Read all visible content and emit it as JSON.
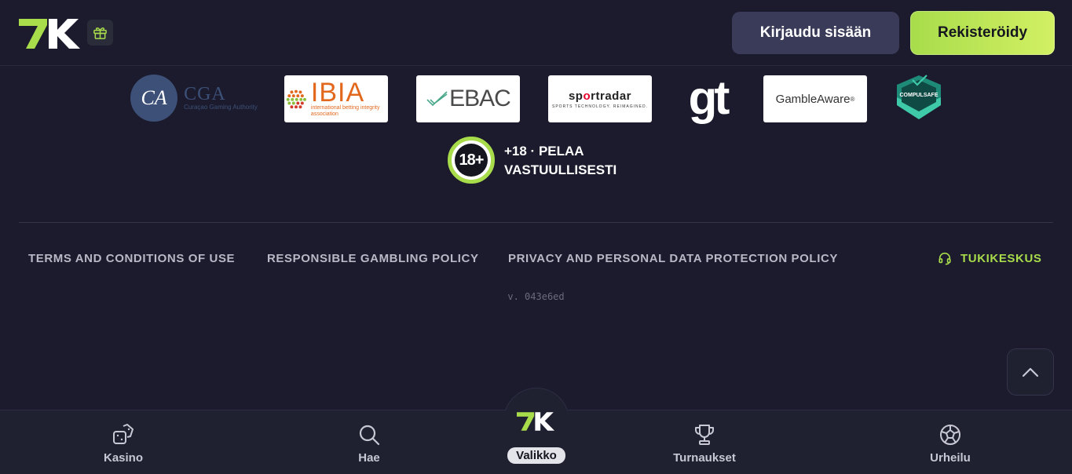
{
  "header": {
    "logo_text": "7K",
    "login_label": "Kirjaudu sisään",
    "register_label": "Rekisteröidy"
  },
  "partners": {
    "cga": {
      "monogram": "CA",
      "title": "CGA",
      "subtitle": "Curaçao Gaming Authority"
    },
    "ibia": {
      "title": "IBIA",
      "subtitle": "international betting integrity association"
    },
    "ebac": {
      "title": "EBAC"
    },
    "sportradar": {
      "title_a": "sp",
      "title_red": "o",
      "title_b": "rtradar",
      "subtitle": "SPORTS TECHNOLOGY. REIMAGINED."
    },
    "gt": {
      "title": "gt"
    },
    "gambleaware": {
      "title": "GambleAware",
      "mark": "®"
    },
    "compulsafe": {
      "title": "COMPULSAFE"
    }
  },
  "age": {
    "badge": "18+",
    "line1": "+18 · PELAA",
    "line2": "VASTUULLISESTI"
  },
  "footer": {
    "links": [
      "TERMS AND CONDITIONS OF USE",
      "RESPONSIBLE GAMBLING POLICY",
      "PRIVACY AND PERSONAL DATA PROTECTION POLICY"
    ],
    "support_label": "TUKIKESKUS",
    "version": "v. 043e6ed"
  },
  "bottom_nav": {
    "items": [
      {
        "label": "Kasino",
        "icon": "dice-icon"
      },
      {
        "label": "Hae",
        "icon": "search-icon"
      },
      {
        "label": "Valikko",
        "icon": "7k-logo-icon"
      },
      {
        "label": "Turnaukset",
        "icon": "trophy-icon"
      },
      {
        "label": "Urheilu",
        "icon": "soccer-ball-icon"
      }
    ]
  },
  "colors": {
    "background": "#1b1b2d",
    "accent": "#a8dc4a",
    "login_button": "#3a3b58",
    "nav_background": "#1f2030"
  }
}
